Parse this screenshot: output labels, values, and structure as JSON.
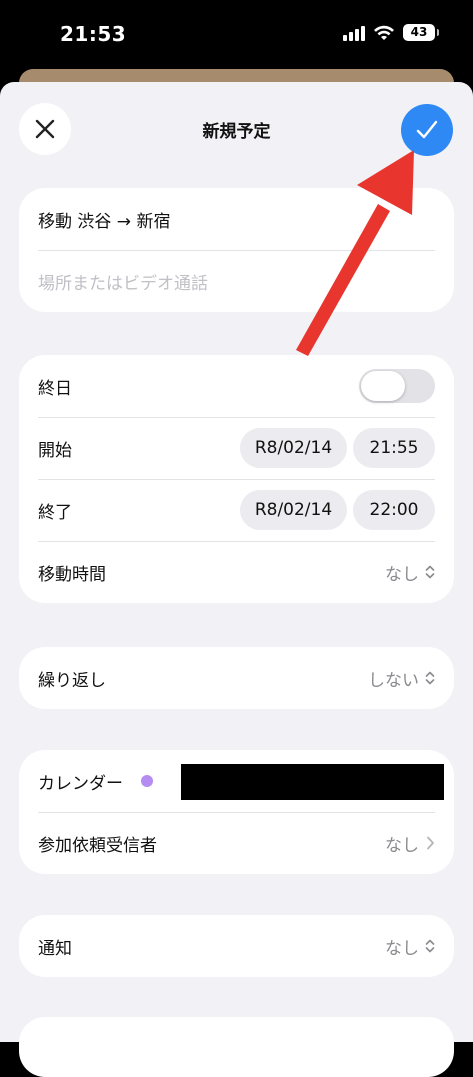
{
  "status_bar": {
    "time": "21:53",
    "battery": "43"
  },
  "nav": {
    "title": "新規予定"
  },
  "event": {
    "title": "移動 渋谷 → 新宿",
    "location_placeholder": "場所またはビデオ通話"
  },
  "schedule": {
    "all_day_label": "終日",
    "all_day": false,
    "start_label": "開始",
    "start_date": "R8/02/14",
    "start_time": "21:55",
    "end_label": "終了",
    "end_date": "R8/02/14",
    "end_time": "22:00",
    "travel_label": "移動時間",
    "travel_value": "なし"
  },
  "repeat": {
    "label": "繰り返し",
    "value": "しない"
  },
  "calendar": {
    "label": "カレンダー",
    "dot_color": "#b58cf2",
    "invitees_label": "参加依頼受信者",
    "invitees_value": "なし"
  },
  "alert": {
    "label": "通知",
    "value": "なし"
  },
  "colors": {
    "accent": "#2f89f5",
    "annotation": "#e8352d"
  }
}
